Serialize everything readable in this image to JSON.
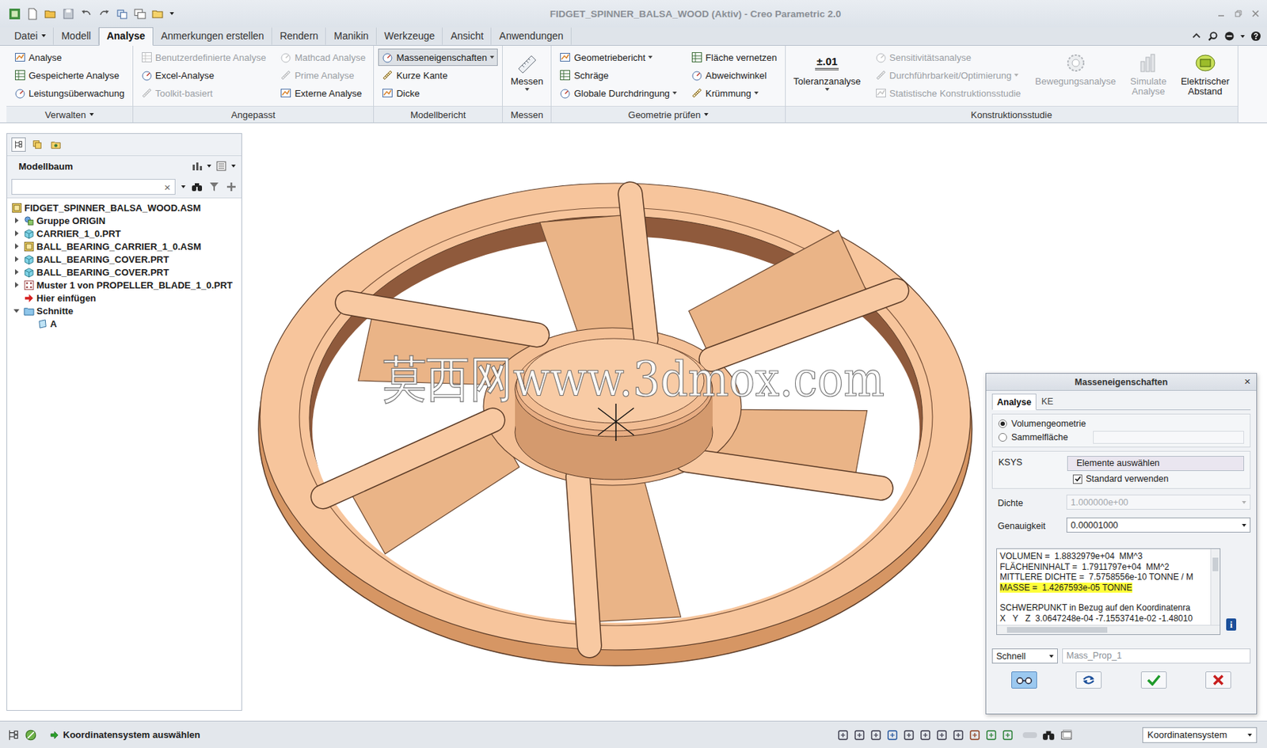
{
  "window": {
    "title": "FIDGET_SPINNER_BALSA_WOOD (Aktiv) - Creo Parametric 2.0"
  },
  "menu_tabs": [
    {
      "label": "Datei",
      "selected": false,
      "dropdown": true
    },
    {
      "label": "Modell",
      "selected": false,
      "dropdown": false
    },
    {
      "label": "Analyse",
      "selected": true,
      "dropdown": false
    },
    {
      "label": "Anmerkungen erstellen",
      "selected": false,
      "dropdown": false
    },
    {
      "label": "Rendern",
      "selected": false,
      "dropdown": false
    },
    {
      "label": "Manikin",
      "selected": false,
      "dropdown": false
    },
    {
      "label": "Werkzeuge",
      "selected": false,
      "dropdown": false
    },
    {
      "label": "Ansicht",
      "selected": false,
      "dropdown": false
    },
    {
      "label": "Anwendungen",
      "selected": false,
      "dropdown": false
    }
  ],
  "ribbon": [
    {
      "label": "Verwalten",
      "dropdown": true,
      "columns": [
        [
          {
            "label": "Analyse",
            "kind": "small",
            "disabled": false,
            "dropdown": false,
            "pressed": false
          },
          {
            "label": "Gespeicherte Analyse",
            "kind": "small",
            "disabled": false,
            "dropdown": false,
            "pressed": false
          },
          {
            "label": "Leistungsüberwachung",
            "kind": "small",
            "disabled": false,
            "dropdown": false,
            "pressed": false
          }
        ]
      ]
    },
    {
      "label": "Angepasst",
      "dropdown": false,
      "columns": [
        [
          {
            "label": "Benutzerdefinierte Analyse",
            "kind": "small",
            "disabled": true,
            "dropdown": false,
            "pressed": false
          },
          {
            "label": "Excel-Analyse",
            "kind": "small",
            "disabled": false,
            "dropdown": false,
            "pressed": false
          },
          {
            "label": "Toolkit-basiert",
            "kind": "small",
            "disabled": true,
            "dropdown": false,
            "pressed": false
          }
        ],
        [
          {
            "label": "Mathcad Analyse",
            "kind": "small",
            "disabled": true,
            "dropdown": false,
            "pressed": false
          },
          {
            "label": "Prime Analyse",
            "kind": "small",
            "disabled": true,
            "dropdown": false,
            "pressed": false
          },
          {
            "label": "Externe Analyse",
            "kind": "small",
            "disabled": false,
            "dropdown": false,
            "pressed": false
          }
        ]
      ]
    },
    {
      "label": "Modellbericht",
      "dropdown": false,
      "columns": [
        [
          {
            "label": "Masseneigenschaften",
            "kind": "small",
            "disabled": false,
            "dropdown": true,
            "pressed": true
          },
          {
            "label": "Kurze Kante",
            "kind": "small",
            "disabled": false,
            "dropdown": false,
            "pressed": false
          },
          {
            "label": "Dicke",
            "kind": "small",
            "disabled": false,
            "dropdown": false,
            "pressed": false
          }
        ]
      ]
    },
    {
      "label": "Messen",
      "dropdown": false,
      "columns": [
        [
          {
            "label": "Messen",
            "kind": "large",
            "disabled": false,
            "dropdown": true,
            "pressed": false
          }
        ]
      ]
    },
    {
      "label": "Geometrie prüfen",
      "dropdown": true,
      "columns": [
        [
          {
            "label": "Geometriebericht",
            "kind": "small",
            "disabled": false,
            "dropdown": true,
            "pressed": false
          },
          {
            "label": "Schräge",
            "kind": "small",
            "disabled": false,
            "dropdown": false,
            "pressed": false
          },
          {
            "label": "Globale Durchdringung",
            "kind": "small",
            "disabled": false,
            "dropdown": true,
            "pressed": false
          }
        ],
        [
          {
            "label": "Fläche vernetzen",
            "kind": "small",
            "disabled": false,
            "dropdown": false,
            "pressed": false
          },
          {
            "label": "Abweichwinkel",
            "kind": "small",
            "disabled": false,
            "dropdown": false,
            "pressed": false
          },
          {
            "label": "Krümmung",
            "kind": "small",
            "disabled": false,
            "dropdown": true,
            "pressed": false
          }
        ]
      ]
    },
    {
      "label": "Konstruktionsstudie",
      "dropdown": false,
      "columns": [
        [
          {
            "label": "Toleranzanalyse",
            "kind": "large",
            "disabled": false,
            "dropdown": true,
            "pressed": false,
            "icon_text": "±.01"
          }
        ],
        [
          {
            "label": "Sensitivitätsanalyse",
            "kind": "small",
            "disabled": true,
            "dropdown": false,
            "pressed": false
          },
          {
            "label": "Durchführbarkeit/Optimierung",
            "kind": "small",
            "disabled": true,
            "dropdown": true,
            "pressed": false
          },
          {
            "label": "Statistische Konstruktionsstudie",
            "kind": "small",
            "disabled": true,
            "dropdown": false,
            "pressed": false
          }
        ],
        [
          {
            "label": "Bewegungsanalyse",
            "kind": "large",
            "disabled": true,
            "dropdown": false,
            "pressed": false
          }
        ],
        [
          {
            "label": "Simulate Analyse",
            "kind": "large",
            "disabled": true,
            "dropdown": false,
            "pressed": false
          }
        ],
        [
          {
            "label": "Elektrischer Abstand",
            "kind": "large",
            "disabled": false,
            "dropdown": false,
            "pressed": false
          }
        ]
      ]
    }
  ],
  "model_tree": {
    "title": "Modellbaum",
    "search_value": "",
    "clear": "×",
    "items": [
      {
        "label": "FIDGET_SPINNER_BALSA_WOOD.ASM",
        "kind": "asm",
        "depth": 0,
        "expandable": false,
        "expanded": false
      },
      {
        "label": "Gruppe ORIGIN",
        "kind": "group",
        "depth": 1,
        "expandable": true,
        "expanded": false
      },
      {
        "label": "CARRIER_1_0.PRT",
        "kind": "part",
        "depth": 1,
        "expandable": true,
        "expanded": false
      },
      {
        "label": "BALL_BEARING_CARRIER_1_0.ASM",
        "kind": "asm",
        "depth": 1,
        "expandable": true,
        "expanded": false
      },
      {
        "label": "BALL_BEARING_COVER.PRT",
        "kind": "part",
        "depth": 1,
        "expandable": true,
        "expanded": false
      },
      {
        "label": "BALL_BEARING_COVER.PRT",
        "kind": "part",
        "depth": 1,
        "expandable": true,
        "expanded": false
      },
      {
        "label": "Muster 1 von PROPELLER_BLADE_1_0.PRT",
        "kind": "pattern",
        "depth": 1,
        "expandable": true,
        "expanded": false
      },
      {
        "label": "Hier einfügen",
        "kind": "insert",
        "depth": 1,
        "expandable": false,
        "expanded": false
      },
      {
        "label": "Schnitte",
        "kind": "folder",
        "depth": 1,
        "expandable": true,
        "expanded": true
      },
      {
        "label": "A",
        "kind": "section",
        "depth": 2,
        "expandable": false,
        "expanded": false
      }
    ]
  },
  "viewport": {
    "watermark": "莫西网www.3dmox.com"
  },
  "dialog": {
    "title": "Masseneigenschaften",
    "close": "×",
    "tabs": [
      {
        "label": "Analyse",
        "selected": true
      },
      {
        "label": "KE",
        "selected": false
      }
    ],
    "geometry_options": [
      {
        "label": "Volumengeometrie",
        "selected": true
      },
      {
        "label": "Sammelfläche",
        "selected": false
      }
    ],
    "ksys": {
      "label": "KSYS",
      "button": "Elemente auswählen",
      "checkbox_label": "Standard verwenden",
      "checked": true
    },
    "density": {
      "label": "Dichte",
      "value": "1.000000e+00",
      "disabled": true
    },
    "accuracy": {
      "label": "Genauigkeit",
      "value": "0.00001000",
      "disabled": false
    },
    "results": [
      {
        "text": "VOLUMEN =  1.8832979e+04  MM^3",
        "highlighted": false,
        "spacer_before": false
      },
      {
        "text": "FLÄCHENINHALT =  1.7911797e+04  MM^2",
        "highlighted": false,
        "spacer_before": false
      },
      {
        "text": "MITTLERE DICHTE =  7.5758556e-10 TONNE / M",
        "highlighted": false,
        "spacer_before": false
      },
      {
        "text": "MASSE =  1.4267593e-05 TONNE",
        "highlighted": true,
        "spacer_before": false
      },
      {
        "text": "SCHWERPUNKT in Bezug auf den Koordinatenra",
        "highlighted": false,
        "spacer_before": true
      },
      {
        "text": "X   Y   Z  3.0647248e-04 -7.1553741e-02 -1.48010",
        "highlighted": false,
        "spacer_before": false
      }
    ],
    "v_scroll": {
      "level": 0.18
    },
    "h_scroll": {
      "level": 0.45
    },
    "info": "i",
    "mode": "Schnell",
    "name": "Mass_Prop_1",
    "buttons": [
      {
        "kind": "preview",
        "pressed": true
      },
      {
        "kind": "repeat",
        "pressed": false
      },
      {
        "kind": "ok",
        "pressed": false
      },
      {
        "kind": "cancel",
        "pressed": false
      }
    ]
  },
  "status_bar": {
    "message": "Koordinatensystem auswählen",
    "filter": "Koordinatensystem"
  }
}
